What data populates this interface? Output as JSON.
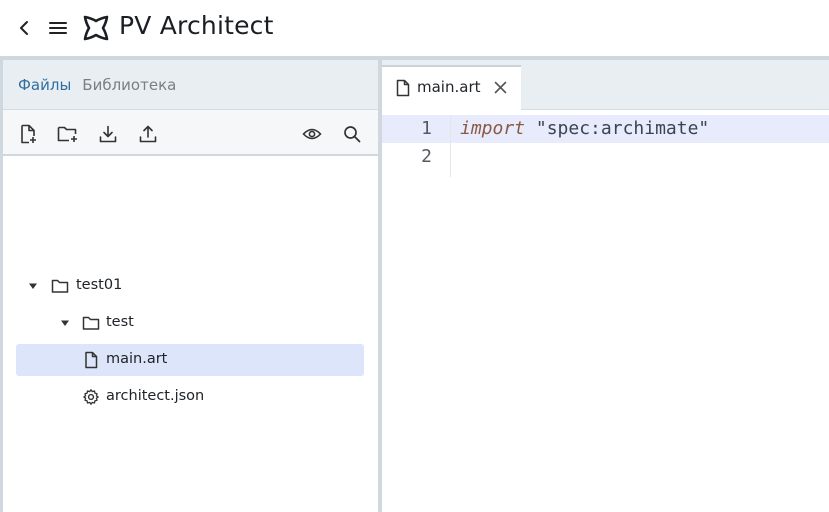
{
  "app": {
    "title": "PV Architect",
    "icons": {
      "back": "chevron-left-icon",
      "menu": "hamburger-menu-icon",
      "logo": "pv-architect-logo"
    }
  },
  "sidebar": {
    "tabs": [
      {
        "label": "Файлы",
        "active": true
      },
      {
        "label": "Библиотека",
        "active": false
      }
    ],
    "toolbar": [
      {
        "name": "new-file-button",
        "icon": "file-plus-icon"
      },
      {
        "name": "new-folder-button",
        "icon": "folder-plus-icon"
      },
      {
        "name": "download-button",
        "icon": "download-icon"
      },
      {
        "name": "upload-button",
        "icon": "upload-icon"
      },
      {
        "name": "preview-button",
        "icon": "eye-icon"
      },
      {
        "name": "search-button",
        "icon": "search-icon"
      }
    ],
    "tree": [
      {
        "label": "test01",
        "type": "folder",
        "expanded": true,
        "depth": 0
      },
      {
        "label": "test",
        "type": "folder",
        "expanded": true,
        "depth": 1
      },
      {
        "label": "main.art",
        "type": "file",
        "selected": true,
        "depth": 2
      },
      {
        "label": "architect.json",
        "type": "settings",
        "depth": 2
      }
    ]
  },
  "editor": {
    "tab": {
      "label": "main.art",
      "icon": "file-icon",
      "close_icon": "close-icon"
    },
    "lines": [
      {
        "number": "1",
        "keyword": "import",
        "text": " \"spec:archimate\""
      },
      {
        "number": "2",
        "keyword": "",
        "text": ""
      }
    ]
  },
  "colors": {
    "accent_tab": "#2f6f9f",
    "selection": "#dde5fa",
    "active_line": "#e8ebfb",
    "panel_header": "#e9eef2",
    "divider": "#cfd8de",
    "keyword": "#8a5a44"
  }
}
